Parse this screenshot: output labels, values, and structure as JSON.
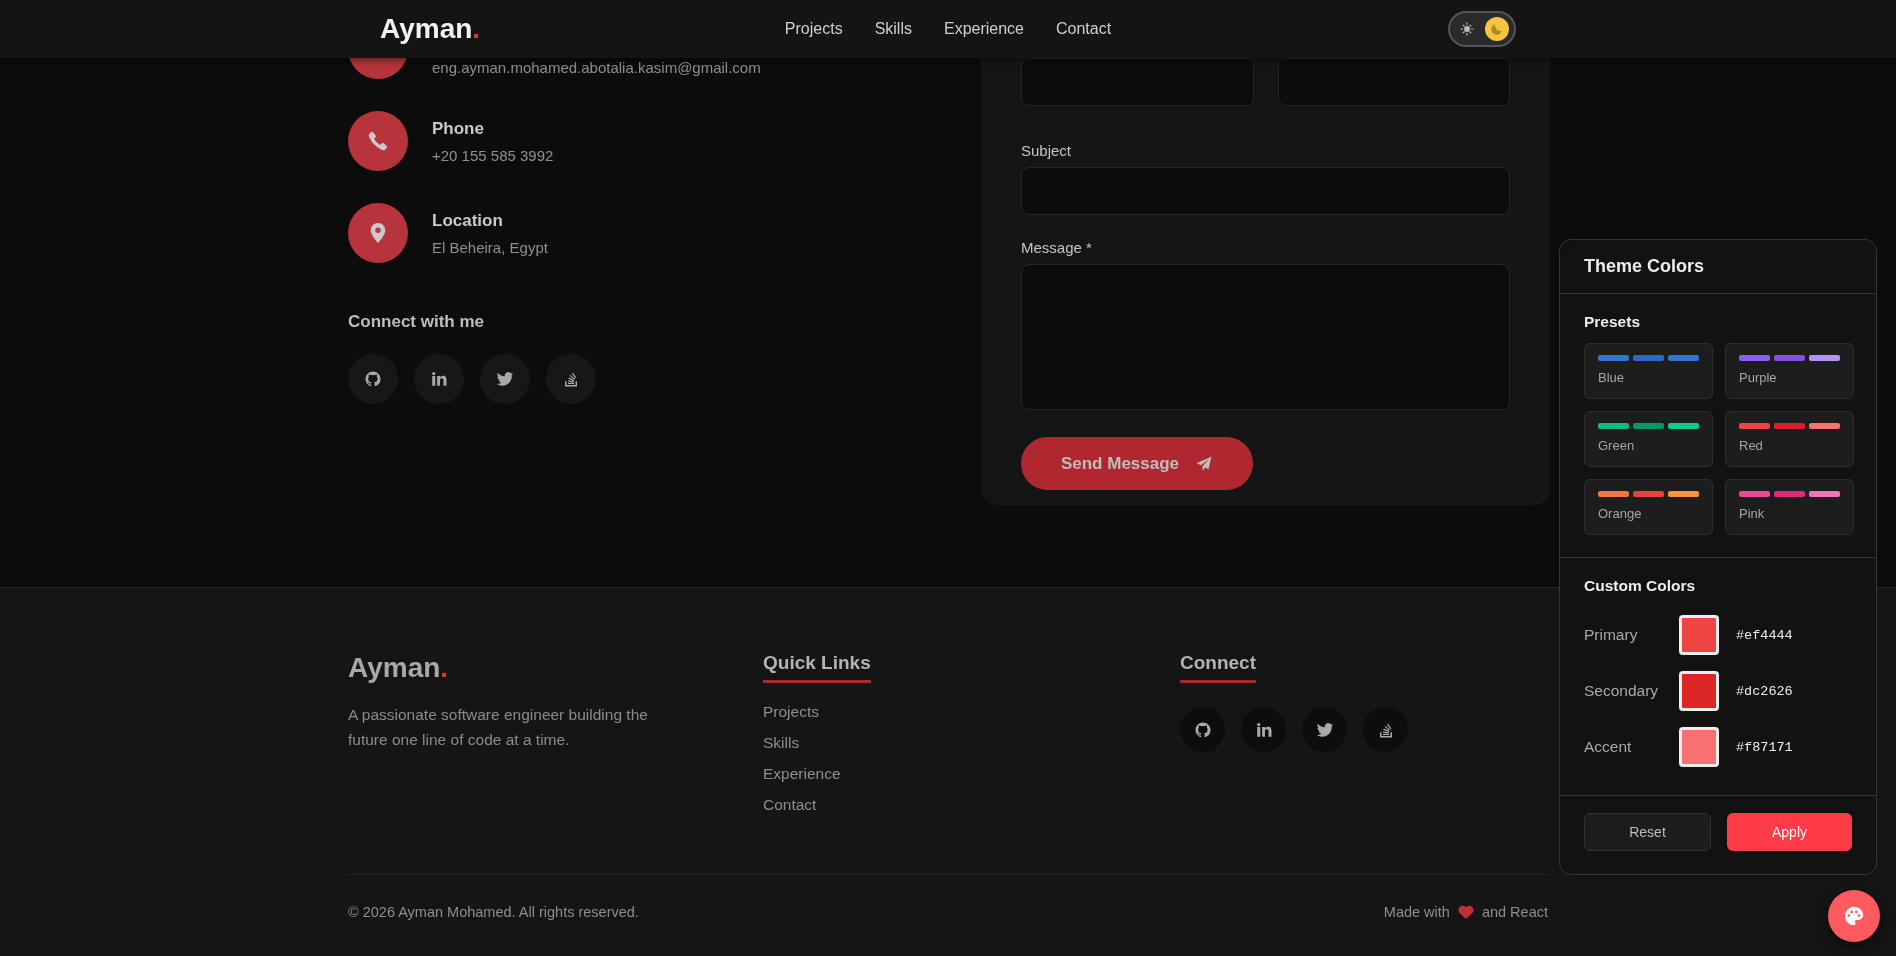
{
  "nav": {
    "logo": "Ayman",
    "logo_mark": ".",
    "links": [
      "Projects",
      "Skills",
      "Experience",
      "Contact"
    ],
    "theme_toggle": [
      {
        "kind": "sun",
        "selected": false
      },
      {
        "kind": "moon",
        "selected": true
      }
    ]
  },
  "contact": {
    "items": [
      {
        "kind": "email",
        "value": "eng.ayman.mohamed.abotalia.kasim@gmail.com"
      },
      {
        "kind": "phone",
        "label": "Phone",
        "value": "+20 155 585 3992"
      },
      {
        "kind": "location",
        "label": "Location",
        "value": "El Beheira, Egypt"
      }
    ],
    "connect_title": "Connect with me",
    "socials": [
      {
        "kind": "github"
      },
      {
        "kind": "linkedin"
      },
      {
        "kind": "twitter"
      },
      {
        "kind": "stack"
      }
    ]
  },
  "form": {
    "fields": [
      {
        "kind": "half"
      },
      {
        "kind": "half"
      },
      {
        "kind": "input",
        "label": "Subject"
      },
      {
        "kind": "textarea",
        "label": "Message *"
      }
    ],
    "submit": "Send Message"
  },
  "footer": {
    "logo": "Ayman",
    "logo_mark": ".",
    "tagline": "A passionate software engineer building the future one line of code at a time.",
    "quick_links_title": "Quick Links",
    "quick_links": [
      "Projects",
      "Skills",
      "Experience",
      "Contact"
    ],
    "connect_title": "Connect",
    "socials": [
      {
        "kind": "github"
      },
      {
        "kind": "linkedin"
      },
      {
        "kind": "twitter"
      },
      {
        "kind": "stack"
      }
    ],
    "copyright": "© 2026 Ayman Mohamed. All rights reserved.",
    "made_with": "Made with",
    "made_with_end": "and React"
  },
  "theme_panel": {
    "title": "Theme Colors",
    "presets_title": "Presets",
    "presets": [
      {
        "name": "Blue",
        "bars": [
          {
            "color": "#2f74d8"
          },
          {
            "color": "#3068c8"
          },
          {
            "color": "#2f74d8"
          }
        ]
      },
      {
        "name": "Purple",
        "bars": [
          {
            "color": "#8b5cf6"
          },
          {
            "color": "#8550e6"
          },
          {
            "color": "#b590f5"
          }
        ]
      },
      {
        "name": "Green",
        "bars": [
          {
            "color": "#10b981"
          },
          {
            "color": "#05966a"
          },
          {
            "color": "#10c98f"
          }
        ]
      },
      {
        "name": "Red",
        "bars": [
          {
            "color": "#ef4444"
          },
          {
            "color": "#dc1f2e"
          },
          {
            "color": "#f87171"
          }
        ]
      },
      {
        "name": "Orange",
        "bars": [
          {
            "color": "#f97340"
          },
          {
            "color": "#ea4040"
          },
          {
            "color": "#fb923c"
          }
        ]
      },
      {
        "name": "Pink",
        "bars": [
          {
            "color": "#ec4899"
          },
          {
            "color": "#df2a7a"
          },
          {
            "color": "#f472b6"
          }
        ]
      }
    ],
    "custom_title": "Custom Colors",
    "custom": [
      {
        "label": "Primary",
        "value": "#ef4444"
      },
      {
        "label": "Secondary",
        "value": "#dc2626"
      },
      {
        "label": "Accent",
        "value": "#f87171"
      }
    ],
    "buttons": [
      {
        "label": "Reset",
        "kind": "secondary"
      },
      {
        "label": "Apply",
        "kind": "primary"
      }
    ]
  }
}
